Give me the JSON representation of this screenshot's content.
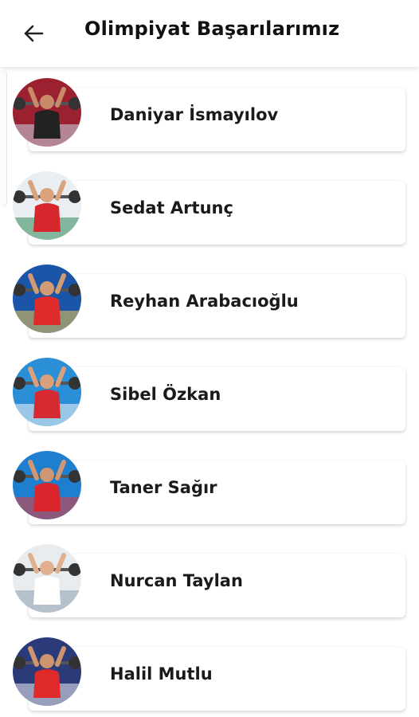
{
  "header": {
    "title": "Olimpiyat Başarılarımız",
    "back_icon": "arrow-left-icon"
  },
  "athletes": [
    {
      "name": "Daniyar İsmayılov",
      "photo": {
        "bg": "#9b2030",
        "accent": "#c9d9e8",
        "skin": "#c98a6a",
        "outfit": "#222222"
      }
    },
    {
      "name": "Sedat Artunç",
      "photo": {
        "bg": "#e8eef2",
        "accent": "#2e8b57",
        "skin": "#d9a37e",
        "outfit": "#d7262e"
      }
    },
    {
      "name": "Reyhan Arabacıoğlu",
      "photo": {
        "bg": "#1a55a8",
        "accent": "#f2c94c",
        "skin": "#d29b75",
        "outfit": "#e02b2b"
      }
    },
    {
      "name": "Sibel Özkan",
      "photo": {
        "bg": "#2a8fd6",
        "accent": "#f6f6f6",
        "skin": "#d8a07c",
        "outfit": "#d42a30"
      }
    },
    {
      "name": "Taner Sağır",
      "photo": {
        "bg": "#1f7fcf",
        "accent": "#e63a3a",
        "skin": "#cf9775",
        "outfit": "#d8262c"
      }
    },
    {
      "name": "Nurcan Taylan",
      "photo": {
        "bg": "#e9ecee",
        "accent": "#8aa0b5",
        "skin": "#e0b08e",
        "outfit": "#ffffff"
      }
    },
    {
      "name": "Halil Mutlu",
      "photo": {
        "bg": "#2b3b7a",
        "accent": "#f1f1f1",
        "skin": "#cf9470",
        "outfit": "#e02a2a"
      }
    }
  ]
}
